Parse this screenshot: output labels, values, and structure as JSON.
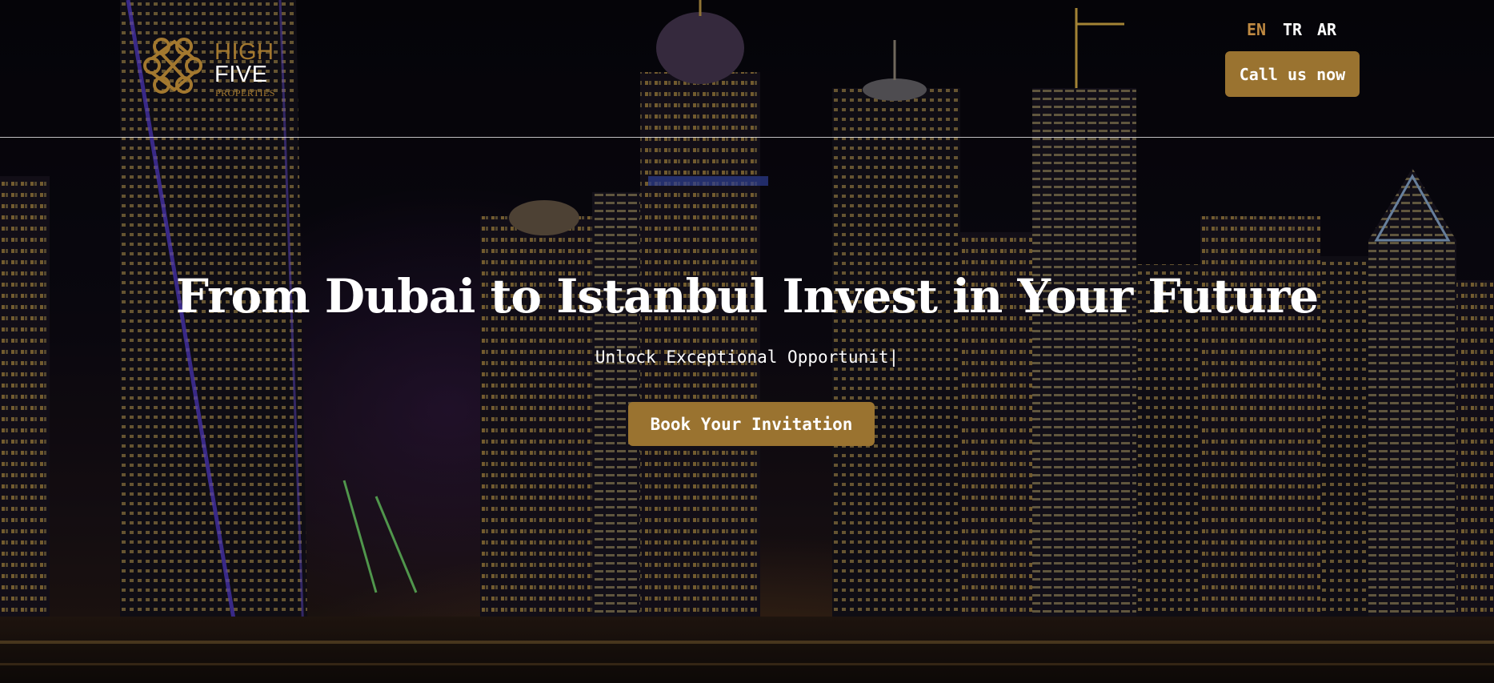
{
  "brand": {
    "word1": "HIGH",
    "word2": "FIVE",
    "word3": "PROPERTIES"
  },
  "header": {
    "languages": [
      "EN",
      "TR",
      "AR"
    ],
    "active_language": "EN",
    "call_label": "Call us now"
  },
  "hero": {
    "headline": "From Dubai to Istanbul Invest in Your Future",
    "subheadline": "Unlock Exceptional Opportunit|",
    "cta_label": "Book Your Invitation",
    "background_image": "night-city-skyline"
  },
  "colors": {
    "accent_gold": "#9a7330",
    "active_language": "#c08a42",
    "text": "#ffffff"
  }
}
